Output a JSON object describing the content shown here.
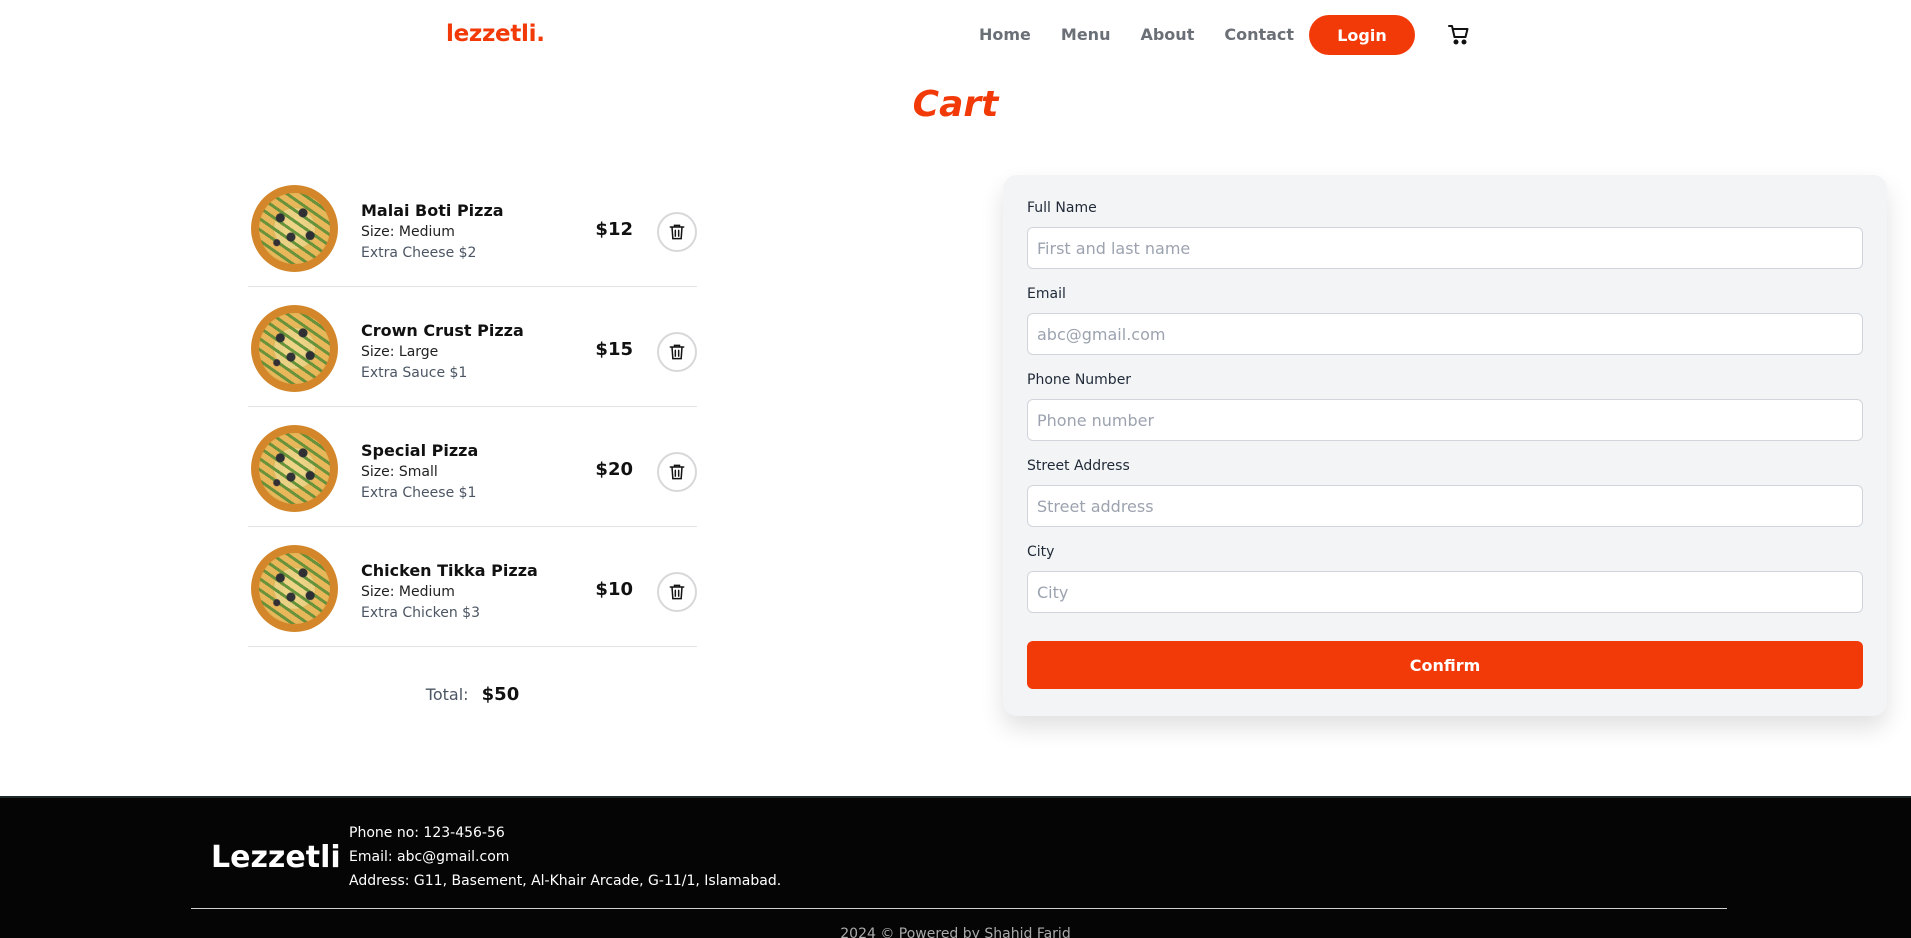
{
  "header": {
    "logo": "lezzetli.",
    "nav": [
      "Home",
      "Menu",
      "About",
      "Contact"
    ],
    "login_label": "Login",
    "cart_icon": "cart-icon"
  },
  "page_title": "Cart",
  "cart": {
    "items": [
      {
        "name": "Malai Boti Pizza",
        "size": "Size: Medium",
        "extra": "Extra Cheese $2",
        "price": "$12"
      },
      {
        "name": "Crown Crust Pizza",
        "size": "Size: Large",
        "extra": "Extra Sauce $1",
        "price": "$15"
      },
      {
        "name": "Special Pizza",
        "size": "Size: Small",
        "extra": "Extra Cheese $1",
        "price": "$20"
      },
      {
        "name": "Chicken Tikka Pizza",
        "size": "Size: Medium",
        "extra": "Extra Chicken $3",
        "price": "$10"
      }
    ],
    "total_label": "Total:",
    "total_value": "$50"
  },
  "form": {
    "fields": [
      {
        "label": "Full Name",
        "placeholder": "First and last name",
        "value": ""
      },
      {
        "label": "Email",
        "placeholder": "abc@gmail.com",
        "value": ""
      },
      {
        "label": "Phone Number",
        "placeholder": "Phone number",
        "value": ""
      },
      {
        "label": "Street Address",
        "placeholder": "Street address",
        "value": ""
      },
      {
        "label": "City",
        "placeholder": "City",
        "value": ""
      }
    ],
    "confirm_label": "Confirm"
  },
  "footer": {
    "brand": "Lezzetli",
    "phone": "Phone no: 123-456-56",
    "email": "Email: abc@gmail.com",
    "address": "Address: G11, Basement, Al-Khair Arcade, G-11/1, Islamabad.",
    "copyright": "2024 © Powered by Shahid Farid"
  },
  "colors": {
    "accent": "#f23a09",
    "footer_bg": "#050505",
    "form_bg": "#f3f4f6"
  }
}
